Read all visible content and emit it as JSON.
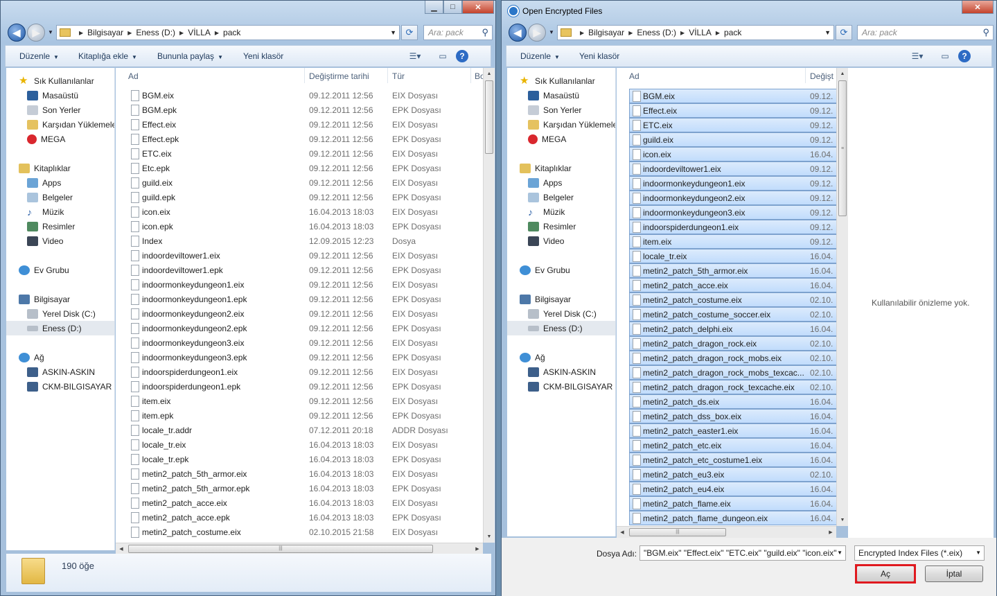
{
  "left_window": {
    "address": [
      "Bilgisayar",
      "Eness (D:)",
      "VİLLA",
      "pack"
    ],
    "search_placeholder": "Ara: pack",
    "commands": {
      "organize": "Düzenle",
      "add_to_library": "Kitaplığa ekle",
      "share": "Bununla paylaş",
      "new_folder": "Yeni klasör"
    },
    "columns": {
      "name": "Ad",
      "date": "Değiştirme tarihi",
      "type": "Tür",
      "size": "Bo"
    },
    "files": [
      [
        "BGM.eix",
        "09.12.2011 12:56",
        "EIX Dosyası"
      ],
      [
        "BGM.epk",
        "09.12.2011 12:56",
        "EPK Dosyası"
      ],
      [
        "Effect.eix",
        "09.12.2011 12:56",
        "EIX Dosyası"
      ],
      [
        "Effect.epk",
        "09.12.2011 12:56",
        "EPK Dosyası"
      ],
      [
        "ETC.eix",
        "09.12.2011 12:56",
        "EIX Dosyası"
      ],
      [
        "Etc.epk",
        "09.12.2011 12:56",
        "EPK Dosyası"
      ],
      [
        "guild.eix",
        "09.12.2011 12:56",
        "EIX Dosyası"
      ],
      [
        "guild.epk",
        "09.12.2011 12:56",
        "EPK Dosyası"
      ],
      [
        "icon.eix",
        "16.04.2013 18:03",
        "EIX Dosyası"
      ],
      [
        "icon.epk",
        "16.04.2013 18:03",
        "EPK Dosyası"
      ],
      [
        "Index",
        "12.09.2015 12:23",
        "Dosya"
      ],
      [
        "indoordeviltower1.eix",
        "09.12.2011 12:56",
        "EIX Dosyası"
      ],
      [
        "indoordeviltower1.epk",
        "09.12.2011 12:56",
        "EPK Dosyası"
      ],
      [
        "indoormonkeydungeon1.eix",
        "09.12.2011 12:56",
        "EIX Dosyası"
      ],
      [
        "indoormonkeydungeon1.epk",
        "09.12.2011 12:56",
        "EPK Dosyası"
      ],
      [
        "indoormonkeydungeon2.eix",
        "09.12.2011 12:56",
        "EIX Dosyası"
      ],
      [
        "indoormonkeydungeon2.epk",
        "09.12.2011 12:56",
        "EPK Dosyası"
      ],
      [
        "indoormonkeydungeon3.eix",
        "09.12.2011 12:56",
        "EIX Dosyası"
      ],
      [
        "indoormonkeydungeon3.epk",
        "09.12.2011 12:56",
        "EPK Dosyası"
      ],
      [
        "indoorspiderdungeon1.eix",
        "09.12.2011 12:56",
        "EIX Dosyası"
      ],
      [
        "indoorspiderdungeon1.epk",
        "09.12.2011 12:56",
        "EPK Dosyası"
      ],
      [
        "item.eix",
        "09.12.2011 12:56",
        "EIX Dosyası"
      ],
      [
        "item.epk",
        "09.12.2011 12:56",
        "EPK Dosyası"
      ],
      [
        "locale_tr.addr",
        "07.12.2011 20:18",
        "ADDR Dosyası"
      ],
      [
        "locale_tr.eix",
        "16.04.2013 18:03",
        "EIX Dosyası"
      ],
      [
        "locale_tr.epk",
        "16.04.2013 18:03",
        "EPK Dosyası"
      ],
      [
        "metin2_patch_5th_armor.eix",
        "16.04.2013 18:03",
        "EIX Dosyası"
      ],
      [
        "metin2_patch_5th_armor.epk",
        "16.04.2013 18:03",
        "EPK Dosyası"
      ],
      [
        "metin2_patch_acce.eix",
        "16.04.2013 18:03",
        "EIX Dosyası"
      ],
      [
        "metin2_patch_acce.epk",
        "16.04.2013 18:03",
        "EPK Dosyası"
      ],
      [
        "metin2_patch_costume.eix",
        "02.10.2015 21:58",
        "EIX Dosyası"
      ]
    ],
    "item_count": "190 öğe"
  },
  "right_window": {
    "title": "Open Encrypted Files",
    "address": [
      "Bilgisayar",
      "Eness (D:)",
      "VİLLA",
      "pack"
    ],
    "search_placeholder": "Ara: pack",
    "commands": {
      "organize": "Düzenle",
      "new_folder": "Yeni klasör"
    },
    "columns": {
      "name": "Ad",
      "date": "Değişt"
    },
    "files": [
      [
        "BGM.eix",
        "09.12."
      ],
      [
        "Effect.eix",
        "09.12."
      ],
      [
        "ETC.eix",
        "09.12."
      ],
      [
        "guild.eix",
        "09.12."
      ],
      [
        "icon.eix",
        "16.04."
      ],
      [
        "indoordeviltower1.eix",
        "09.12."
      ],
      [
        "indoormonkeydungeon1.eix",
        "09.12."
      ],
      [
        "indoormonkeydungeon2.eix",
        "09.12."
      ],
      [
        "indoormonkeydungeon3.eix",
        "09.12."
      ],
      [
        "indoorspiderdungeon1.eix",
        "09.12."
      ],
      [
        "item.eix",
        "09.12."
      ],
      [
        "locale_tr.eix",
        "16.04."
      ],
      [
        "metin2_patch_5th_armor.eix",
        "16.04."
      ],
      [
        "metin2_patch_acce.eix",
        "16.04."
      ],
      [
        "metin2_patch_costume.eix",
        "02.10."
      ],
      [
        "metin2_patch_costume_soccer.eix",
        "02.10."
      ],
      [
        "metin2_patch_delphi.eix",
        "16.04."
      ],
      [
        "metin2_patch_dragon_rock.eix",
        "02.10."
      ],
      [
        "metin2_patch_dragon_rock_mobs.eix",
        "02.10."
      ],
      [
        "metin2_patch_dragon_rock_mobs_texcac...",
        "02.10."
      ],
      [
        "metin2_patch_dragon_rock_texcache.eix",
        "02.10."
      ],
      [
        "metin2_patch_ds.eix",
        "16.04."
      ],
      [
        "metin2_patch_dss_box.eix",
        "16.04."
      ],
      [
        "metin2_patch_easter1.eix",
        "16.04."
      ],
      [
        "metin2_patch_etc.eix",
        "16.04."
      ],
      [
        "metin2_patch_etc_costume1.eix",
        "16.04."
      ],
      [
        "metin2_patch_eu3.eix",
        "02.10."
      ],
      [
        "metin2_patch_eu4.eix",
        "16.04."
      ],
      [
        "metin2_patch_flame.eix",
        "16.04."
      ],
      [
        "metin2_patch_flame_dungeon.eix",
        "16.04."
      ]
    ],
    "preview_text": "Kullanılabilir önizleme yok.",
    "filename_label": "Dosya Adı:",
    "filename_value": "\"BGM.eix\" \"Effect.eix\" \"ETC.eix\" \"guild.eix\" \"icon.eix\"",
    "filter_value": "Encrypted Index Files (*.eix)",
    "open_button": "Aç",
    "cancel_button": "İptal"
  },
  "nav": {
    "favorites": "Sık Kullanılanlar",
    "desktop": "Masaüstü",
    "recent": "Son Yerler",
    "downloads": "Karşıdan Yüklemeler",
    "mega": "MEGA",
    "libraries": "Kitaplıklar",
    "apps": "Apps",
    "documents": "Belgeler",
    "music": "Müzik",
    "pictures": "Resimler",
    "video": "Video",
    "homegroup": "Ev Grubu",
    "computer": "Bilgisayar",
    "local_disk": "Yerel Disk (C:)",
    "eness": "Eness (D:)",
    "network": "Ağ",
    "pc1": "ASKIN-ASKIN",
    "pc2": "CKM-BILGISAYAR"
  }
}
